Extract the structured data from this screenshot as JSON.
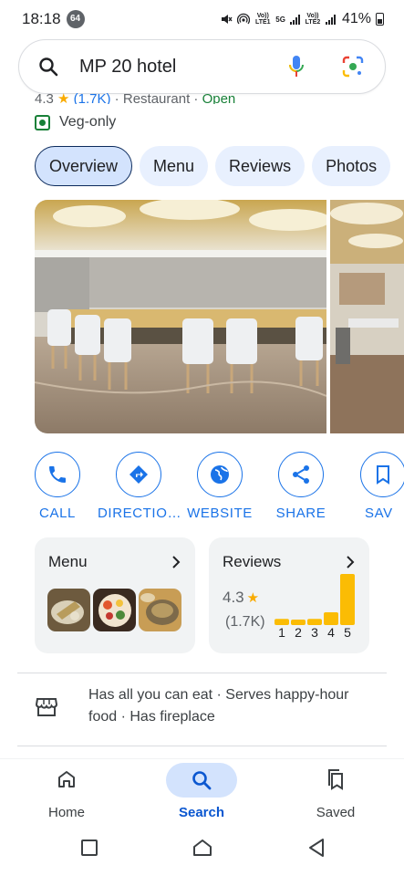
{
  "status_bar": {
    "time": "18:18",
    "notification_count": "64",
    "network_1": "Vo)) LTE1",
    "network_2": "Vo)) LTE2",
    "network_5g": "5G",
    "battery": "41%"
  },
  "search": {
    "query": "MP 20 hotel",
    "colors": {
      "mic": "#4285f4",
      "lens": "#4285f4"
    }
  },
  "place": {
    "clipped_line": {
      "rating": "4.3",
      "count": "(1.7K)",
      "category": "Restaurant",
      "status": "Open"
    },
    "veg_label": "Veg-only"
  },
  "tabs": [
    {
      "label": "Overview",
      "active": true
    },
    {
      "label": "Menu",
      "active": false
    },
    {
      "label": "Reviews",
      "active": false
    },
    {
      "label": "Photos",
      "active": false
    }
  ],
  "actions": [
    {
      "label": "CALL",
      "icon": "phone-icon"
    },
    {
      "label": "DIRECTIO…",
      "icon": "directions-icon"
    },
    {
      "label": "WEBSITE",
      "icon": "globe-icon"
    },
    {
      "label": "SHARE",
      "icon": "share-icon"
    },
    {
      "label": "SAV",
      "icon": "bookmark-icon"
    }
  ],
  "menu_card": {
    "title": "Menu"
  },
  "reviews_card": {
    "title": "Reviews",
    "rating": "4.3",
    "count": "(1.7K)"
  },
  "chart_data": {
    "type": "bar",
    "categories": [
      "1",
      "2",
      "3",
      "4",
      "5"
    ],
    "values": [
      0.12,
      0.06,
      0.12,
      0.25,
      1.0
    ],
    "ylim": [
      0,
      1
    ],
    "title": "",
    "xlabel": "",
    "ylabel": "",
    "color": "#fbbc04",
    "grid": false
  },
  "amenities": {
    "text": "Has all you can eat · Serves happy-hour food · Has fireplace"
  },
  "bottom_nav": [
    {
      "label": "Home",
      "icon": "home-icon",
      "active": false
    },
    {
      "label": "Search",
      "icon": "search-icon",
      "active": true
    },
    {
      "label": "Saved",
      "icon": "saved-icon",
      "active": false
    }
  ]
}
